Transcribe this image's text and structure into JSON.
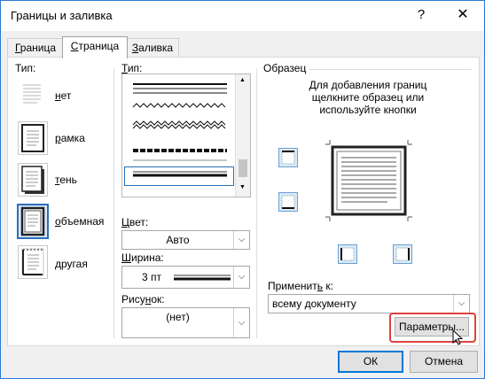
{
  "window": {
    "title": "Границы и заливка",
    "help_glyph": "?",
    "close_glyph": "✕"
  },
  "tabs": [
    {
      "label_pre": "",
      "label_key": "Г",
      "label_post": "раница"
    },
    {
      "label_pre": "",
      "label_key": "С",
      "label_post": "траница"
    },
    {
      "label_pre": "",
      "label_key": "З",
      "label_post": "аливка"
    }
  ],
  "type_section": {
    "label": "Тип:",
    "items": [
      {
        "label_key": "н",
        "label_post": "ет"
      },
      {
        "label_key": "р",
        "label_post": "амка"
      },
      {
        "label_key": "т",
        "label_post": "ень"
      },
      {
        "label_key": "о",
        "label_post": "бъемная"
      },
      {
        "label_key": "д",
        "label_post": "ругая"
      }
    ]
  },
  "style_section": {
    "label_key": "Т",
    "label_post": "ип:"
  },
  "color": {
    "label_key": "Ц",
    "label_post": "вет:",
    "value": "Авто"
  },
  "width": {
    "label_key": "Ш",
    "label_post": "ирина:",
    "value": "3 пт"
  },
  "art": {
    "label_pre": "Рису",
    "label_key": "н",
    "label_post": "ок:",
    "value": "(нет)"
  },
  "preview": {
    "label": "Образец",
    "hint_line1": "Для добавления границ",
    "hint_line2": "щелкните образец или",
    "hint_line3": "используйте кнопки"
  },
  "apply_to": {
    "label_pre": "Применит",
    "label_key": "ь",
    "label_post": " к:",
    "value": "всему документу"
  },
  "buttons": {
    "options": "Параметры...",
    "ok": "ОК",
    "cancel": "Отмена"
  },
  "colors": {
    "accent": "#2c6fb7",
    "highlight": "#e04040"
  },
  "dropdown_arrow": "⌵"
}
